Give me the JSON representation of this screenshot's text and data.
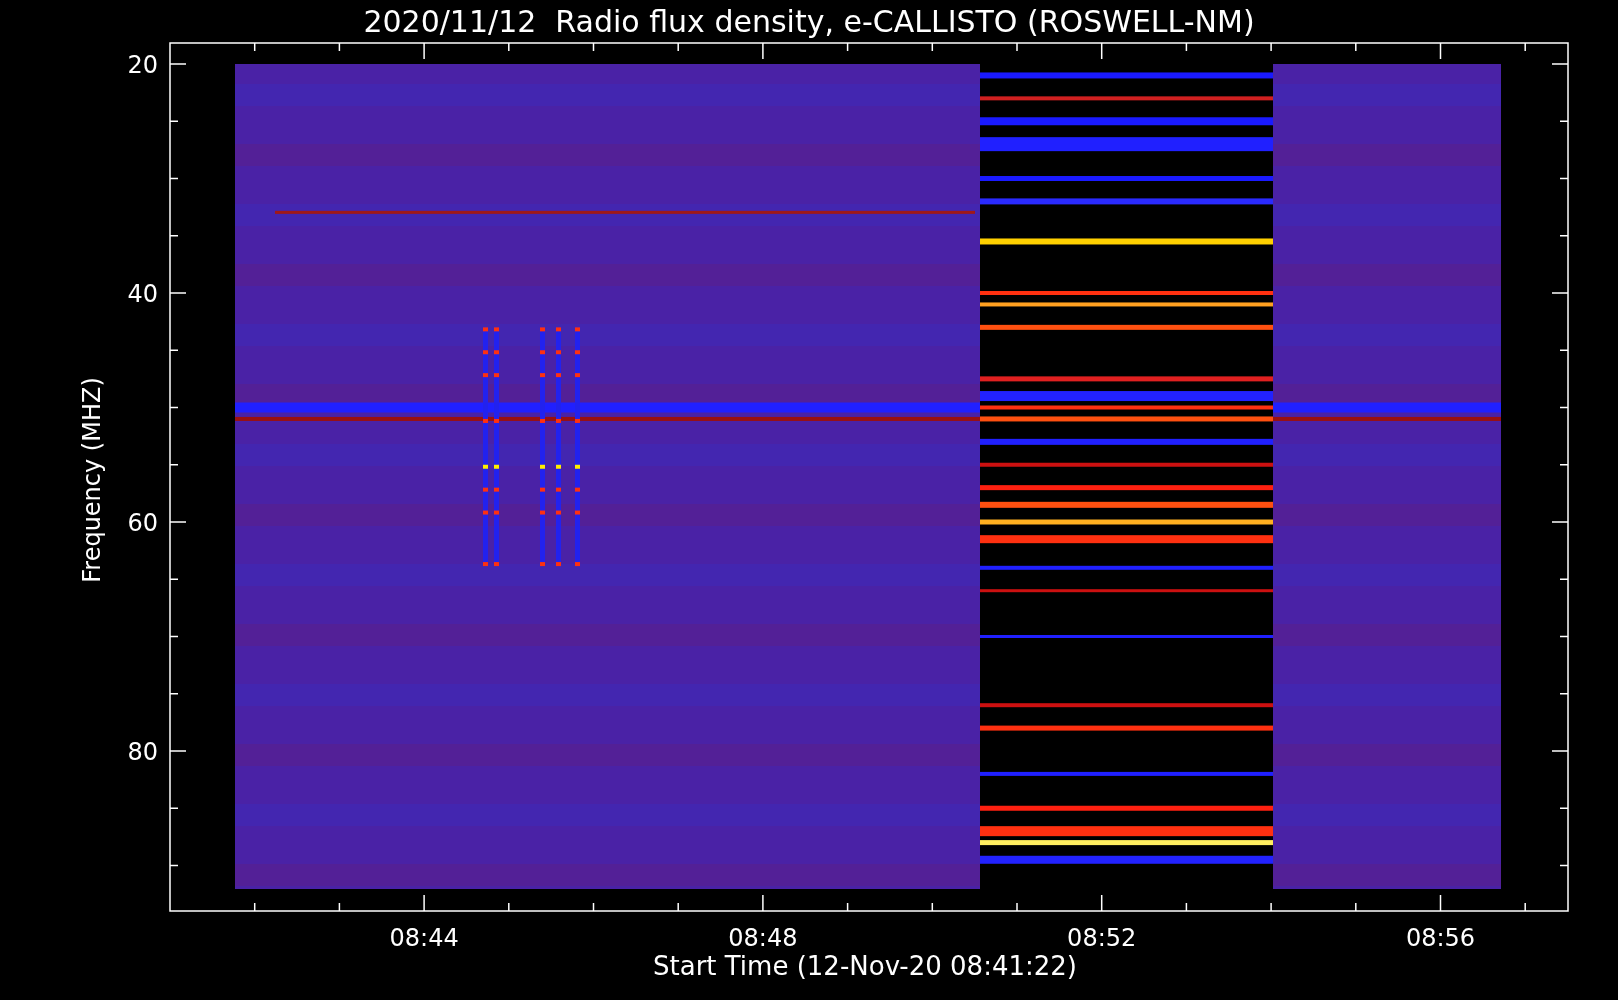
{
  "plot": {
    "title": "2020/11/12  Radio flux density, e-CALLISTO (ROSWELL-NM)",
    "ylabel": "Frequency (MHZ)",
    "yticks": [
      "20",
      "40",
      "60",
      "80"
    ],
    "xticks": [
      "08:44",
      "08:48",
      "08:52",
      "08:56"
    ],
    "xlabel": "Start Time (12-Nov-20 08:41:22)"
  }
}
